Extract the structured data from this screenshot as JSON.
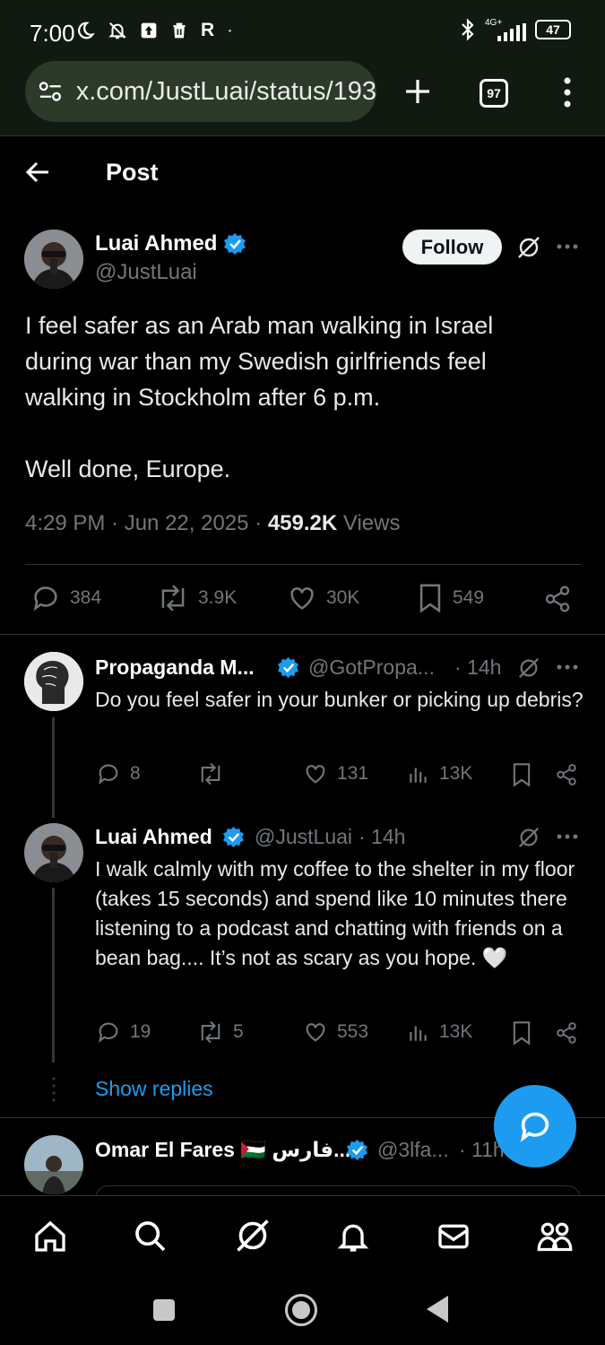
{
  "status_bar": {
    "time": "7:00",
    "battery": "47",
    "network": "4G+"
  },
  "browser": {
    "url": "x.com/JustLuai/status/193",
    "tab_count": "97"
  },
  "header": {
    "title": "Post"
  },
  "post": {
    "author_name": "Luai Ahmed",
    "author_handle": "@JustLuai",
    "follow_label": "Follow",
    "text_line1": "I feel safer as an Arab man walking in Israel",
    "text_line2": "during war than my Swedish girlfriends feel",
    "text_line3": "walking in Stockholm after 6 p.m.",
    "text_line4": "Well done, Europe.",
    "timestamp": "4:29 PM · Jun 22, 2025 · ",
    "views_count": "459.2K",
    "views_label": " Views",
    "stats": {
      "replies": "384",
      "reposts": "3.9K",
      "likes": "30K",
      "bookmarks": "549"
    }
  },
  "replies": [
    {
      "name": "Propaganda M...",
      "handle": "@GotPropa...",
      "time": "· 14h",
      "text": "Do you feel safer in your bunker or picking up debris?",
      "stats": {
        "replies": "8",
        "reposts": "",
        "likes": "131",
        "views": "13K"
      }
    },
    {
      "name": "Luai Ahmed",
      "handle": "@JustLuai",
      "time": "· 14h",
      "text": "I walk calmly with my coffee to the shelter in my floor (takes 15 seconds) and spend like 10 minutes there listening to a podcast and chatting with friends on a bean bag.... It’s not as scary as you hope. 🤍",
      "stats": {
        "replies": "19",
        "reposts": "5",
        "likes": "553",
        "views": "13K"
      }
    },
    {
      "name": "Omar El Fares 🇵🇸 فارس...",
      "handle": "@3lfa...",
      "time": "· 11h"
    }
  ],
  "show_replies_label": "Show replies",
  "colors": {
    "accent": "#1d9bf0",
    "muted": "#71767b",
    "background": "#000000"
  }
}
